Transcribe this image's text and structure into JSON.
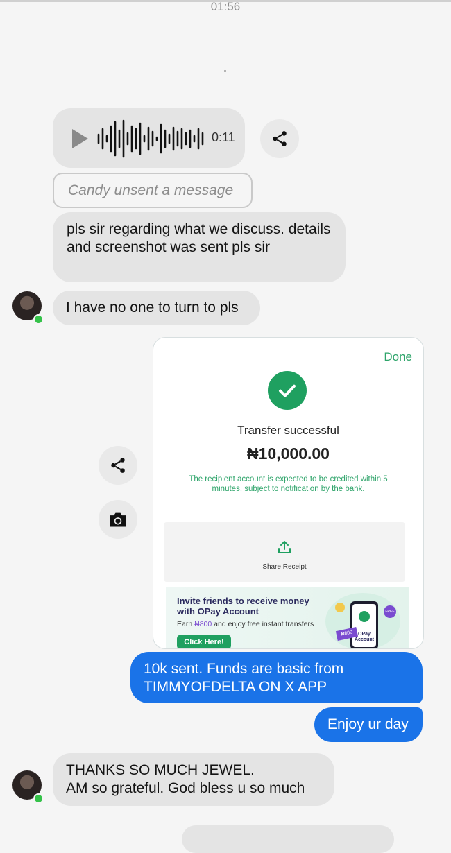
{
  "status": {
    "time": "01:56"
  },
  "voice_message": {
    "duration": "0:11"
  },
  "unsent_notice": "Candy unsent a message",
  "messages": {
    "incoming_1": "pls sir regarding what we discuss. details and screenshot  was sent pls sir",
    "incoming_2": "I have no one to turn to pls",
    "outgoing_1": "10k sent. Funds are basic from TIMMYOFDELTA  ON X APP",
    "outgoing_2": "Enjoy ur day",
    "incoming_3_line1": "THANKS SO MUCH JEWEL.",
    "incoming_3_line2": "AM so grateful.  God bless u so much"
  },
  "receipt": {
    "done_label": "Done",
    "title": "Transfer successful",
    "amount": "₦10,000.00",
    "note": "The recipient account is expected to be credited within 5 minutes, subject to notification by the bank.",
    "share_label": "Share Receipt",
    "promo": {
      "title": "Invite friends to receive money with OPay Account",
      "earn_prefix": "Earn ",
      "earn_amount": "₦800",
      "earn_suffix": " and enjoy free instant transfers",
      "button": "Click Here!",
      "badge": "FREE",
      "ticket": "₦800",
      "phone_label": "OPay Account"
    }
  },
  "colors": {
    "outgoing_bubble": "#1a73e8",
    "incoming_bubble": "#e4e4e4",
    "success_green": "#1fa060",
    "online_dot": "#35c24a"
  },
  "icons": [
    "play-icon",
    "waveform-icon",
    "share-icon",
    "camera-icon",
    "check-icon",
    "upload-icon",
    "avatar"
  ]
}
